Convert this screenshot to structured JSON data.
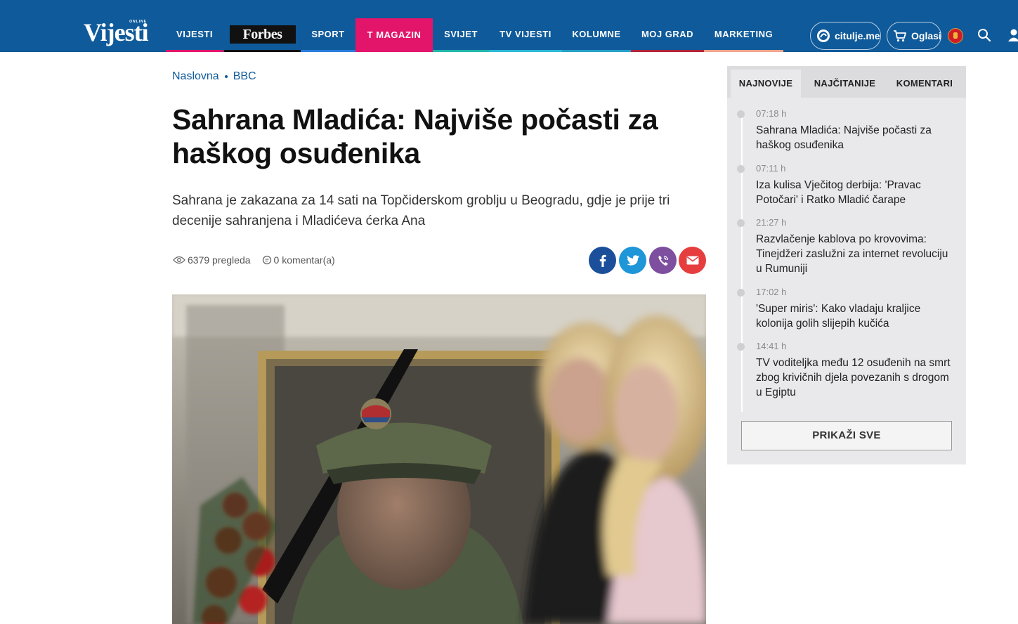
{
  "brand": {
    "logo_text": "Vijesti",
    "logo_tag": "ONLINE"
  },
  "nav": {
    "items": [
      {
        "label": "VIJESTI",
        "color": "#e2156b"
      },
      {
        "label": "Forbes",
        "color": "#111111"
      },
      {
        "label": "SPORT",
        "color": "#2a7de1"
      },
      {
        "label": "T MAGAZIN",
        "color": "#e2156b"
      },
      {
        "label": "SVIJET",
        "color": "#1fb8a9"
      },
      {
        "label": "TV VIJESTI",
        "color": "#2bb9d6"
      },
      {
        "label": "KOLUMNE",
        "color": "#26a0c8"
      },
      {
        "label": "MOJ GRAD",
        "color": "#b1243a"
      },
      {
        "label": "MARKETING",
        "color": "#f0a58c"
      }
    ],
    "citulje_label": "citulje.me",
    "oglasi_label": "Oglasi"
  },
  "article": {
    "breadcrumb": [
      "Naslovna",
      "BBC"
    ],
    "headline": "Sahrana Mladića: Najviše počasti za haškog osuđenika",
    "lead": "Sahrana je zakazana za 14 sati na Topčiderskom groblju u Beogradu, gdje je prije tri decenije sahranjena i Mladićeva ćerka Ana",
    "views": "6379 pregleda",
    "comments": "0 komentar(a)",
    "share": [
      {
        "network": "facebook",
        "icon": "facebook-icon",
        "color": "#1b4f9a"
      },
      {
        "network": "twitter",
        "icon": "twitter-icon",
        "color": "#1e96d8"
      },
      {
        "network": "viber",
        "icon": "viber-icon",
        "color": "#7d4f9e"
      },
      {
        "network": "email",
        "icon": "mail-icon",
        "color": "#e63e3e"
      }
    ]
  },
  "sidebar": {
    "tabs": [
      "NAJNOVIJE",
      "NAJČITANIJE",
      "KOMENTARI"
    ],
    "news": [
      {
        "time": "07:18 h",
        "title": "Sahrana Mladića: Najviše počasti za haškog osuđenika"
      },
      {
        "time": "07:11 h",
        "title": "Iza kulisa Vječitog derbija: 'Pravac Potočari' i Ratko Mladić čarape"
      },
      {
        "time": "21:27 h",
        "title": "Razvlačenje kablova po krovovima: Tinejdžeri zaslužni za internet revoluciju u Rumuniji"
      },
      {
        "time": "17:02 h",
        "title": "'Super miris': Kako vladaju kraljice kolonija golih slijepih kučića"
      },
      {
        "time": "14:41 h",
        "title": "TV voditeljka među 12 osuđenih na smrt zbog krivičnih djela povezanih s drogom u Egiptu"
      }
    ],
    "show_all": "PRIKAŽI SVE"
  }
}
